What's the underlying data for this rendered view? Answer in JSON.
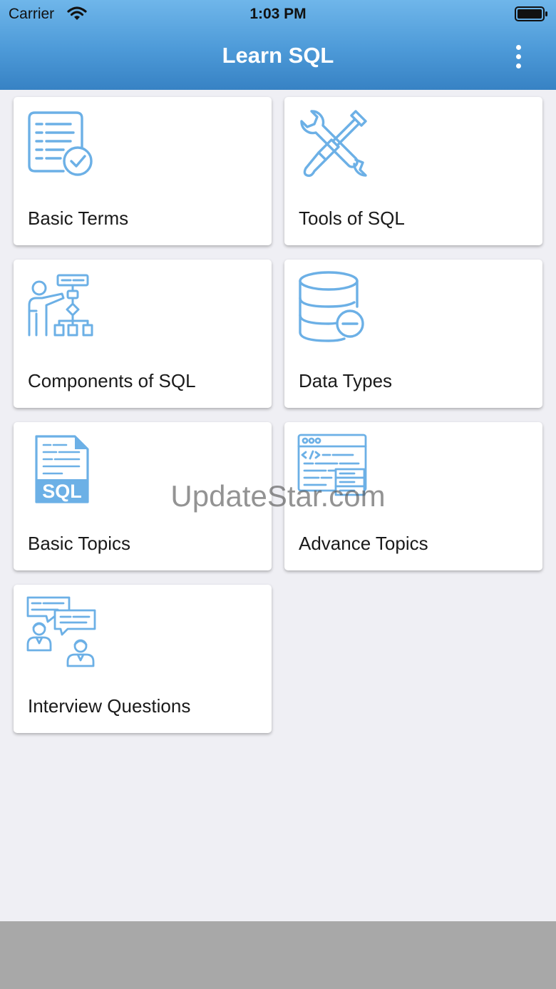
{
  "status_bar": {
    "carrier": "Carrier",
    "time": "1:03 PM",
    "icons": [
      "wifi-icon",
      "battery-icon"
    ]
  },
  "header": {
    "title": "Learn SQL",
    "menu_icon": "more-vertical-icon"
  },
  "colors": {
    "header_top": "#6fb6ea",
    "header_bottom": "#3782c4",
    "icon_blue": "#6cb0e6",
    "background": "#efeff4",
    "card": "#ffffff",
    "bottom_bar": "#a8a8a8"
  },
  "topics": [
    {
      "label": "Basic Terms",
      "icon": "checklist-document-icon"
    },
    {
      "label": "Tools of SQL",
      "icon": "wrench-screwdriver-icon"
    },
    {
      "label": "Components of SQL",
      "icon": "presenter-flowchart-icon"
    },
    {
      "label": "Data Types",
      "icon": "database-minus-icon"
    },
    {
      "label": "Basic Topics",
      "icon": "sql-file-icon"
    },
    {
      "label": "Advance Topics",
      "icon": "code-window-server-icon"
    },
    {
      "label": "Interview Questions",
      "icon": "conversation-people-icon"
    }
  ],
  "watermark": "UpdateStar.com"
}
